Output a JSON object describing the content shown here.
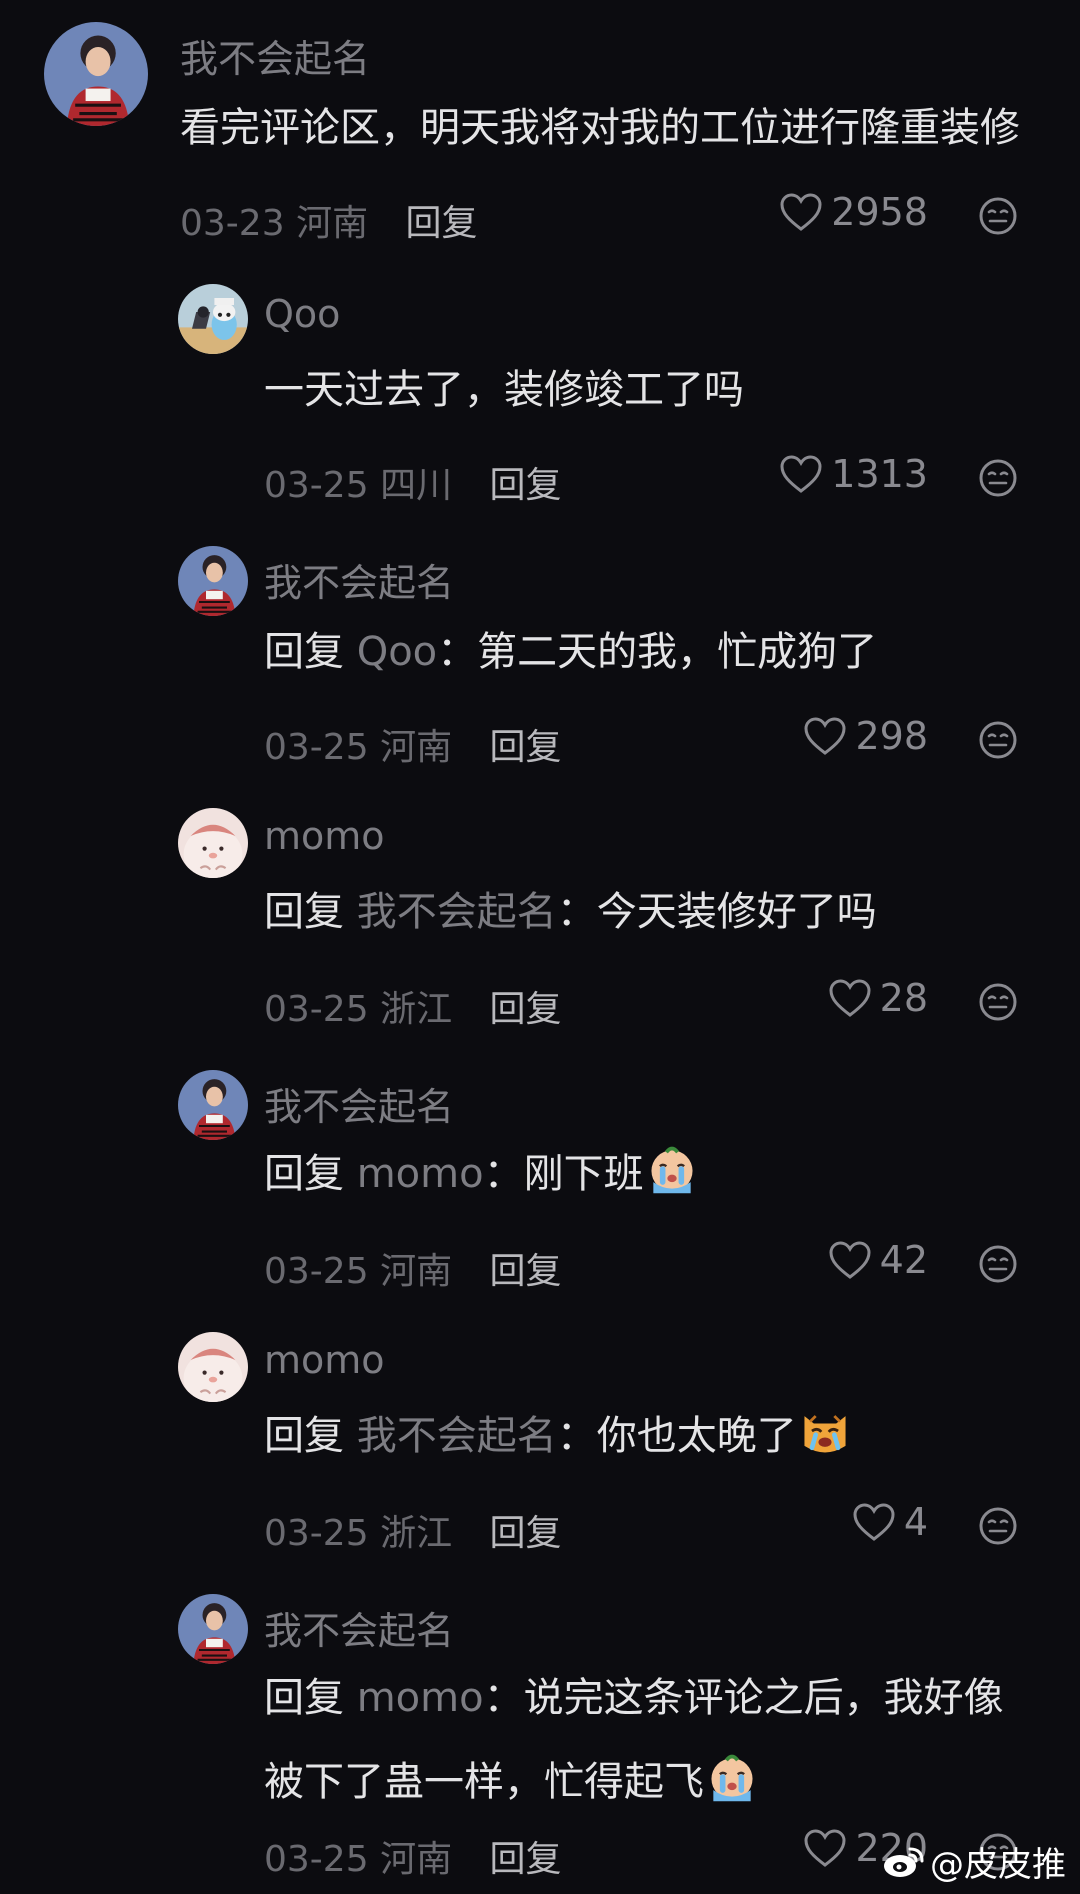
{
  "comments": [
    {
      "username": "我不会起名",
      "text": "看完评论区，明天我将对我的工位进行隆重装修",
      "date": "03-23",
      "location": "河南",
      "reply": "回复",
      "likes": "2958"
    },
    {
      "username": "Qoo",
      "text": "一天过去了，装修竣工了吗",
      "date": "03-25",
      "location": "四川",
      "reply": "回复",
      "likes": "1313"
    },
    {
      "username": "我不会起名",
      "reply_prefix": "回复",
      "reply_target": "Qoo",
      "text": "：第二天的我，忙成狗了",
      "date": "03-25",
      "location": "河南",
      "reply": "回复",
      "likes": "298"
    },
    {
      "username": "momo",
      "reply_prefix": "回复",
      "reply_target": "我不会起名",
      "text": "：今天装修好了吗",
      "date": "03-25",
      "location": "浙江",
      "reply": "回复",
      "likes": "28"
    },
    {
      "username": "我不会起名",
      "reply_prefix": "回复",
      "reply_target": "momo",
      "text": "：刚下班",
      "date": "03-25",
      "location": "河南",
      "reply": "回复",
      "likes": "42"
    },
    {
      "username": "momo",
      "reply_prefix": "回复",
      "reply_target": "我不会起名",
      "text": "：你也太晚了",
      "date": "03-25",
      "location": "浙江",
      "reply": "回复",
      "likes": "4"
    },
    {
      "username": "我不会起名",
      "reply_prefix": "回复",
      "reply_target": "momo",
      "text": "：说完这条评论之后，我好像",
      "text2": "被下了蛊一样，忙得起飞",
      "date": "03-25",
      "location": "河南",
      "reply": "回复",
      "likes": "220"
    }
  ],
  "icons": {
    "like": "heart-outline-icon",
    "dislike": "meh-face-icon",
    "emoji_cry": "crying-emoji",
    "emoji_cat": "crying-cat-emoji",
    "weibo": "weibo-logo-icon"
  },
  "watermark": "@皮皮推",
  "colors": {
    "background": "#0c0c10",
    "username": "#7d7d83",
    "text": "#e4e4e6"
  }
}
